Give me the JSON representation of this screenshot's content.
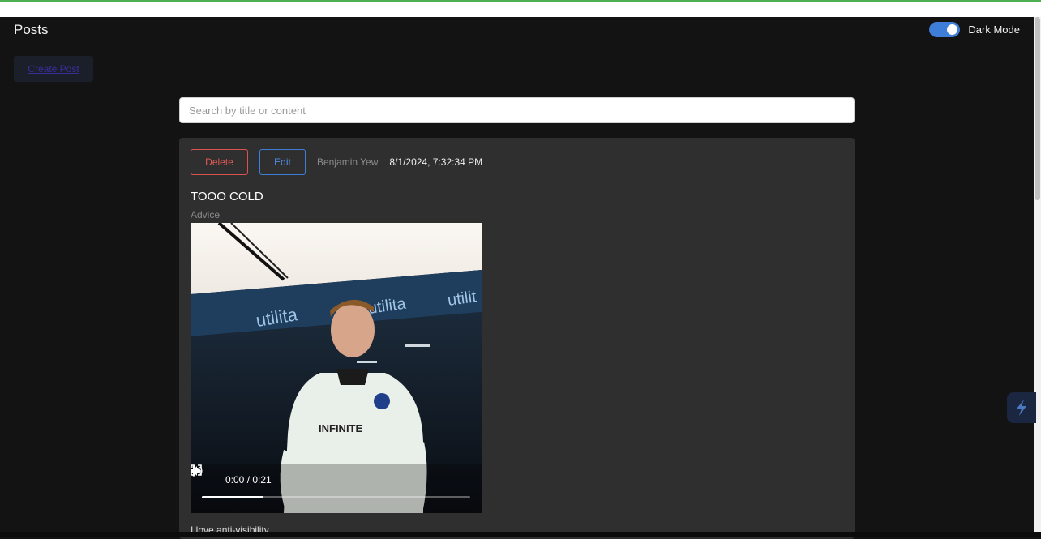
{
  "header": {
    "title": "Posts"
  },
  "theme_toggle": {
    "label": "Dark Mode",
    "enabled": true,
    "accent": "#3f7ed8"
  },
  "create_post": {
    "label": "Create Post"
  },
  "search": {
    "placeholder": "Search by title or content",
    "value": ""
  },
  "post": {
    "delete_label": "Delete",
    "edit_label": "Edit",
    "author": "Benjamin Yew",
    "timestamp": "8/1/2024, 7:32:34 PM",
    "title": "TOOO COLD",
    "category": "Advice",
    "video": {
      "time": "0:00 / 0:21",
      "progress": 0.23,
      "icons": [
        "play-icon",
        "volume-icon",
        "fullscreen-icon",
        "more-options-icon"
      ]
    },
    "body_partial": "I love anti-visibility"
  },
  "colors": {
    "background": "#131313",
    "card": "#2f2f2f",
    "danger": "#d9534f",
    "primary": "#3f7ed8"
  }
}
